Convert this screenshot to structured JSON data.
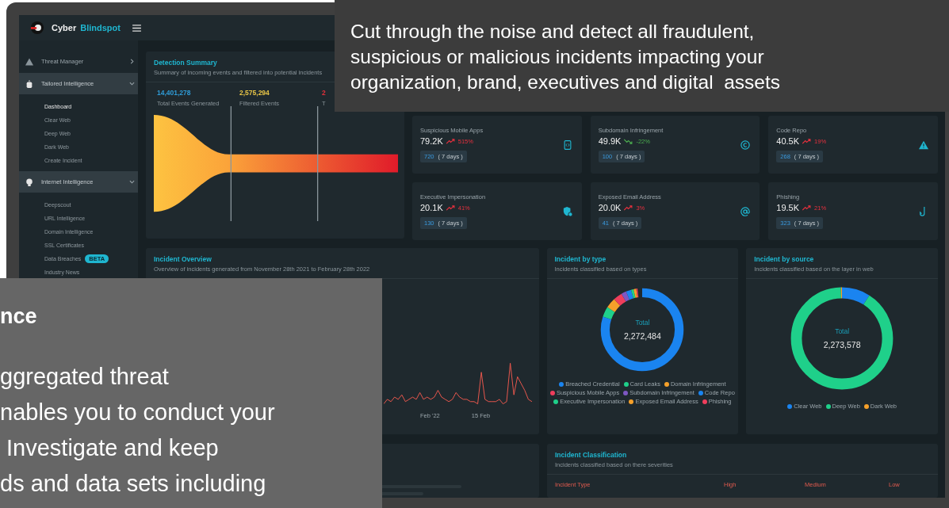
{
  "header": {
    "brand": "Cyber",
    "brand_accent": "Blindspot"
  },
  "sidebar": {
    "groups": [
      {
        "label": "Threat Manager",
        "expanded": false
      },
      {
        "label": "Tailored Intelligence",
        "expanded": true,
        "children": [
          {
            "label": "Dashboard",
            "selected": true
          },
          {
            "label": "Clear Web",
            "selected": false
          },
          {
            "label": "Deep Web",
            "selected": false
          },
          {
            "label": "Dark Web",
            "selected": false
          },
          {
            "label": "Create Incident",
            "selected": false
          }
        ]
      },
      {
        "label": "Internet Intelligence",
        "expanded": true,
        "children": [
          {
            "label": "Deepscout",
            "selected": false
          },
          {
            "label": "URL Intelligence",
            "selected": false
          },
          {
            "label": "Domain Intelligence",
            "selected": false
          },
          {
            "label": "SSL Certificates",
            "selected": false
          },
          {
            "label": "Data Breaches",
            "selected": false,
            "badge": "BETA"
          },
          {
            "label": "Industry News",
            "selected": false
          }
        ]
      }
    ]
  },
  "detection_summary": {
    "title": "Detection Summary",
    "subtitle": "Summary of incoming events and filtered into potential incidents",
    "stages": [
      {
        "value": "14,401,278",
        "label": "Total Events Generated",
        "color": "#2f9bd6"
      },
      {
        "value": "2,575,294",
        "label": "Filtered Events",
        "color": "#e8c547"
      },
      {
        "value": "2",
        "label": "T",
        "color": "#e0303a"
      }
    ]
  },
  "stat_cards": [
    {
      "title": "Suspicious Mobile Apps",
      "value": "79.2K",
      "rising": true,
      "change": "515%",
      "count": "720",
      "period": "( 7 days )"
    },
    {
      "title": "Subdomain Infringement",
      "value": "49.9K",
      "rising": false,
      "change": "-22%",
      "count": "100",
      "period": "( 7 days )"
    },
    {
      "title": "Code Repo",
      "value": "40.5K",
      "rising": true,
      "change": "19%",
      "count": "268",
      "period": "( 7 days )"
    },
    {
      "title": "Executive Impersonation",
      "value": "20.1K",
      "rising": true,
      "change": "41%",
      "count": "130",
      "period": "( 7 days )"
    },
    {
      "title": "Exposed Email Address",
      "value": "20.0K",
      "rising": true,
      "change": "3%",
      "count": "41",
      "period": "( 7 days )"
    },
    {
      "title": "Phishing",
      "value": "19.5K",
      "rising": true,
      "change": "21%",
      "count": "323",
      "period": "( 7 days )"
    }
  ],
  "incident_overview": {
    "title": "Incident Overview",
    "subtitle": "Overview of incidents generated from November 28th 2021 to February 28th 2022",
    "x_labels": [
      "Feb '22",
      "15 Feb"
    ]
  },
  "incident_by_type": {
    "title": "Incident by type",
    "subtitle": "Incidents classified based on types",
    "total_label": "Total",
    "total": "2,272,484",
    "legend": [
      {
        "label": "Breached Credential",
        "color": "#1a84f0"
      },
      {
        "label": "Card Leaks",
        "color": "#1fd08a"
      },
      {
        "label": "Domain Infringement",
        "color": "#f5a02a"
      },
      {
        "label": "Suspicious Mobile Apps",
        "color": "#ef3e5c"
      },
      {
        "label": "Subdomain Infringement",
        "color": "#7e57c2"
      },
      {
        "label": "Code Repo",
        "color": "#1a84f0"
      },
      {
        "label": "Executive Impersonation",
        "color": "#1fd08a"
      },
      {
        "label": "Exposed Email Address",
        "color": "#f5a02a"
      },
      {
        "label": "Phishing",
        "color": "#ef3e5c"
      }
    ]
  },
  "incident_by_source": {
    "title": "Incident by source",
    "subtitle": "Incidents classified based on the layer in web",
    "total_label": "Total",
    "total": "2,273,578",
    "legend": [
      {
        "label": "Clear Web",
        "color": "#1a84f0"
      },
      {
        "label": "Deep Web",
        "color": "#1fd08a"
      },
      {
        "label": "Dark Web",
        "color": "#f5a02a"
      }
    ]
  },
  "incident_classification": {
    "title": "Incident Classification",
    "subtitle": "Incidents classified based on there severities",
    "columns": [
      "Incident Type",
      "High",
      "Medium",
      "Low"
    ]
  },
  "callout_top": {
    "lines": [
      "Cut through the noise and detect all fraudulent,",
      "suspicious or malicious incidents impacting your",
      "organization, brand, executives and digital  assets"
    ]
  },
  "callout_left": {
    "heading": "nce",
    "lines": [
      "ggregated threat",
      "nables you to conduct your",
      " Investigate and keep",
      "ds and data sets including"
    ]
  }
}
